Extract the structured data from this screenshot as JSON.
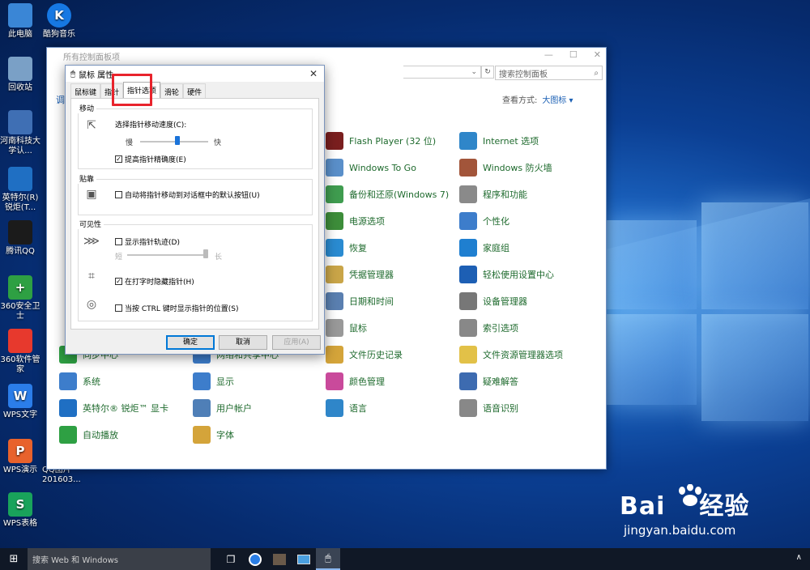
{
  "desktop": {
    "icons": [
      {
        "label": "此电脑",
        "icon": "computer-icon",
        "color": "#3a86d6"
      },
      {
        "label": "酷狗音乐",
        "icon": "kugou-icon",
        "color": "#1678e3",
        "glyph": "K"
      },
      {
        "label": "回收站",
        "icon": "recycle-bin-icon",
        "color": "#7aa0c6"
      },
      {
        "label": "河南科技大学认...",
        "icon": "network-app-icon",
        "color": "#3f6fb4"
      },
      {
        "label": "英特尔(R) 锐炬(T...",
        "icon": "intel-icon",
        "color": "#1f6fc3"
      },
      {
        "label": "腾讯QQ",
        "icon": "qq-icon",
        "color": "#1b1b1b"
      },
      {
        "label": "360安全卫士",
        "icon": "360-safe-icon",
        "color": "#2ea043",
        "glyph": "+"
      },
      {
        "label": "360软件管家",
        "icon": "360-soft-icon",
        "color": "#e7392d"
      },
      {
        "label": "WPS文字",
        "icon": "wps-writer-icon",
        "color": "#2b7de9",
        "glyph": "W"
      },
      {
        "label": "WPS演示",
        "icon": "wps-present-icon",
        "color": "#e8622c",
        "glyph": "P"
      },
      {
        "label": "WPS表格",
        "icon": "wps-sheet-icon",
        "color": "#19a35b",
        "glyph": "S"
      }
    ],
    "partial_label": "QQ图片201603..."
  },
  "control_panel": {
    "title": "所有控制面板项",
    "controls": [
      "—",
      "☐",
      "✕"
    ],
    "address_chevron": "⌄",
    "refresh": "↻",
    "search_placeholder": "搜索控制面板",
    "heading": "调",
    "view_label": "查看方式:",
    "view_value": "大图标 ▾",
    "items": [
      {
        "label": "Flash Player (32 位)",
        "icon": "flash-icon",
        "color": "#7a1f1f"
      },
      {
        "label": "Internet 选项",
        "icon": "internet-options-icon",
        "color": "#2f86c9"
      },
      {
        "label": "Windows To Go",
        "icon": "windows-to-go-icon",
        "color": "#5a8fc9"
      },
      {
        "label": "Windows 防火墙",
        "icon": "firewall-icon",
        "color": "#a2553a"
      },
      {
        "label": "备份和还原(Windows 7)",
        "icon": "backup-icon",
        "color": "#3f9c4f"
      },
      {
        "label": "程序和功能",
        "icon": "programs-icon",
        "color": "#8a8a8a"
      },
      {
        "label": "电源选项",
        "icon": "power-icon",
        "color": "#3d8d3a"
      },
      {
        "label": "个性化",
        "icon": "personalize-icon",
        "color": "#3d7dcb"
      },
      {
        "label": "恢复",
        "icon": "recovery-icon",
        "color": "#2a8bd1"
      },
      {
        "label": "家庭组",
        "icon": "homegroup-icon",
        "color": "#1f7fd0"
      },
      {
        "label": "凭据管理器",
        "icon": "credential-icon",
        "color": "#c9a548"
      },
      {
        "label": "轻松使用设置中心",
        "icon": "ease-of-access-icon",
        "color": "#1d5fb4"
      },
      {
        "label": "日期和时间",
        "icon": "datetime-icon",
        "color": "#5a7fb0"
      },
      {
        "label": "设备管理器",
        "icon": "device-manager-icon",
        "color": "#777"
      },
      {
        "label": "鼠标",
        "icon": "mouse-icon",
        "color": "#999"
      },
      {
        "label": "索引选项",
        "icon": "indexing-icon",
        "color": "#888"
      },
      {
        "label": "同步中心",
        "icon": "sync-icon",
        "color": "#2ea043"
      },
      {
        "label": "网络和共享中心",
        "icon": "network-icon",
        "color": "#3d7dcb"
      },
      {
        "label": "文件历史记录",
        "icon": "file-history-icon",
        "color": "#d4a43a"
      },
      {
        "label": "文件资源管理器选项",
        "icon": "explorer-options-icon",
        "color": "#e2c148"
      },
      {
        "label": "系统",
        "icon": "system-icon",
        "color": "#3d7dcb"
      },
      {
        "label": "显示",
        "icon": "display-icon",
        "color": "#3d7dcb"
      },
      {
        "label": "颜色管理",
        "icon": "color-management-icon",
        "color": "#c94a9b"
      },
      {
        "label": "疑难解答",
        "icon": "troubleshoot-icon",
        "color": "#3d6bb0"
      },
      {
        "label": "英特尔® 锐炬™ 显卡",
        "icon": "intel-graphics-icon",
        "color": "#1f6fc3"
      },
      {
        "label": "用户帐户",
        "icon": "user-accounts-icon",
        "color": "#4f7fb7"
      },
      {
        "label": "语言",
        "icon": "language-icon",
        "color": "#2f86c9"
      },
      {
        "label": "语音识别",
        "icon": "speech-icon",
        "color": "#888"
      },
      {
        "label": "自动播放",
        "icon": "autoplay-icon",
        "color": "#2ea043"
      },
      {
        "label": "字体",
        "icon": "fonts-icon",
        "color": "#d4a43a"
      }
    ]
  },
  "dialog": {
    "title": "鼠标 属性",
    "close": "✕",
    "tabs": [
      "鼠标键",
      "指针",
      "指针选项",
      "滑轮",
      "硬件"
    ],
    "active_tab": "指针选项",
    "groups": {
      "motion": {
        "label": "移动",
        "speed_label": "选择指针移动速度(C):",
        "slow": "慢",
        "fast": "快",
        "speed_level_percent": 55,
        "precision": {
          "label": "提高指针精确度(E)",
          "checked": true
        }
      },
      "snap": {
        "label": "贴靠",
        "option": {
          "label": "自动将指针移动到对话框中的默认按钮(U)",
          "checked": false
        }
      },
      "visibility": {
        "label": "可见性",
        "trails": {
          "label": "显示指针轨迹(D)",
          "checked": false
        },
        "short": "短",
        "long": "长",
        "trail_level_percent": 100,
        "hide_typing": {
          "label": "在打字时隐藏指针(H)",
          "checked": true
        },
        "show_ctrl": {
          "label": "当按 CTRL 键时显示指针的位置(S)",
          "checked": false
        }
      }
    },
    "buttons": {
      "ok": "确定",
      "cancel": "取消",
      "apply": "应用(A)"
    }
  },
  "taskbar": {
    "start": "⊞",
    "search_placeholder": "搜索 Web 和 Windows",
    "apps": [
      "task-view-icon",
      "sogou-icon",
      "explorer-icon",
      "photo-icon",
      "mouse-settings-icon"
    ],
    "tray": "∧"
  },
  "watermark": {
    "brand": "Bai",
    "brand_cn": "经验",
    "url": "jingyan.baidu.com"
  }
}
